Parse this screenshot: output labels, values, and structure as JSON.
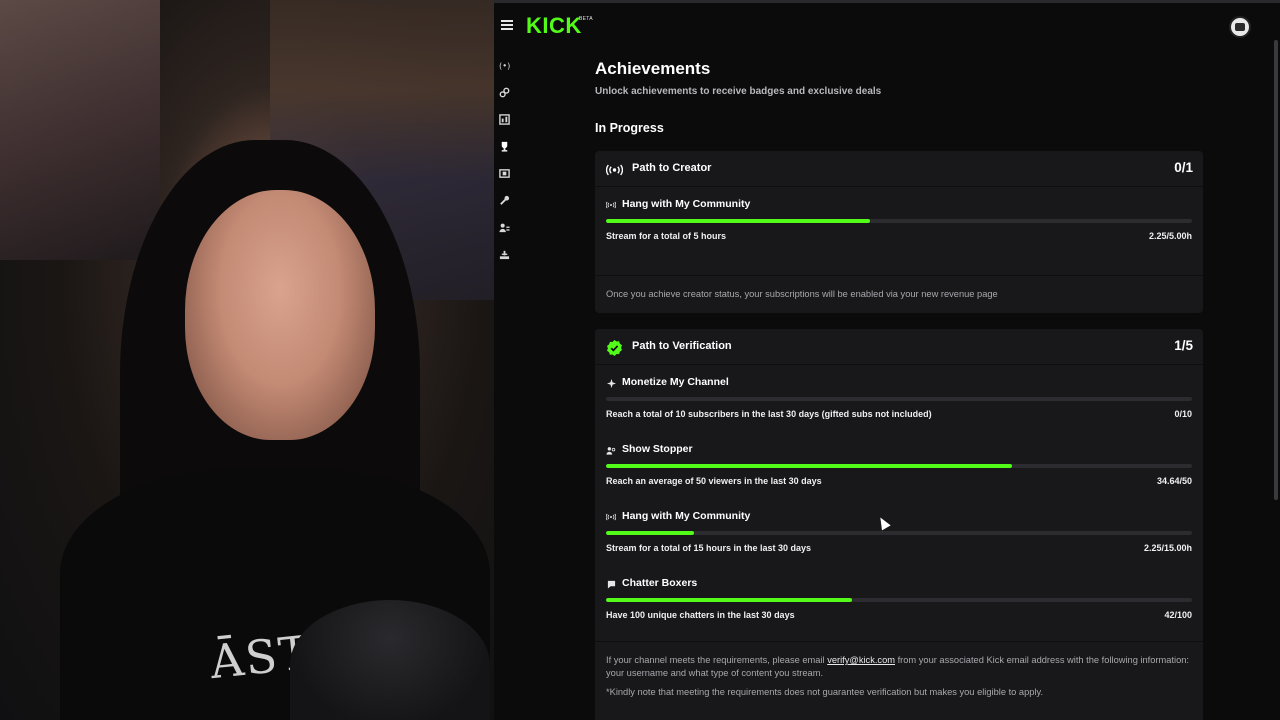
{
  "header": {
    "logo": "KICK",
    "logo_badge": "BETA"
  },
  "sidebar": {
    "icons": [
      "broadcast-icon",
      "link-icon",
      "dashboard-icon",
      "trophy-icon",
      "media-icon",
      "wrench-icon",
      "community-icon",
      "creator-icon"
    ]
  },
  "page": {
    "title": "Achievements",
    "subtitle": "Unlock achievements to receive badges and exclusive deals",
    "section": "In Progress"
  },
  "cards": [
    {
      "title": "Path to Creator",
      "count": "0/1",
      "achievements": [
        {
          "name": "Hang with My Community",
          "icon": "broadcast-icon",
          "desc": "Stream for a total of 5 hours",
          "value": "2.25/5.00h",
          "progress": 0.45
        }
      ],
      "note": "Once you achieve creator status, your subscriptions will be enabled via your new revenue page"
    },
    {
      "title": "Path to Verification",
      "count": "1/5",
      "achievements": [
        {
          "name": "Monetize My Channel",
          "icon": "sparkle-icon",
          "desc": "Reach a total of 10 subscribers in the last 30 days (gifted subs not included)",
          "value": "0/10",
          "progress": 0.0
        },
        {
          "name": "Show Stopper",
          "icon": "users-icon",
          "desc": "Reach an average of 50 viewers in the last 30 days",
          "value": "34.64/50",
          "progress": 0.6928
        },
        {
          "name": "Hang with My Community",
          "icon": "broadcast-icon",
          "desc": "Stream for a total of 15 hours in the last 30 days",
          "value": "2.25/15.00h",
          "progress": 0.15
        },
        {
          "name": "Chatter Boxers",
          "icon": "chat-icon",
          "desc": "Have 100 unique chatters in the last 30 days",
          "value": "42/100",
          "progress": 0.42
        }
      ],
      "note_prefix": "If your channel meets the requirements, please email ",
      "note_email": "verify@kick.com",
      "note_suffix": " from your associated Kick email address with the following information: your username and what type of content you stream.",
      "note2": "*Kindly note that meeting the requirements does not guarantee verification but makes you eligible to apply."
    }
  ],
  "webcam": {
    "shirt_text": "ĀST"
  },
  "colors": {
    "accent": "#53fc18",
    "card_bg": "#18181b",
    "track": "#2b2b30"
  }
}
